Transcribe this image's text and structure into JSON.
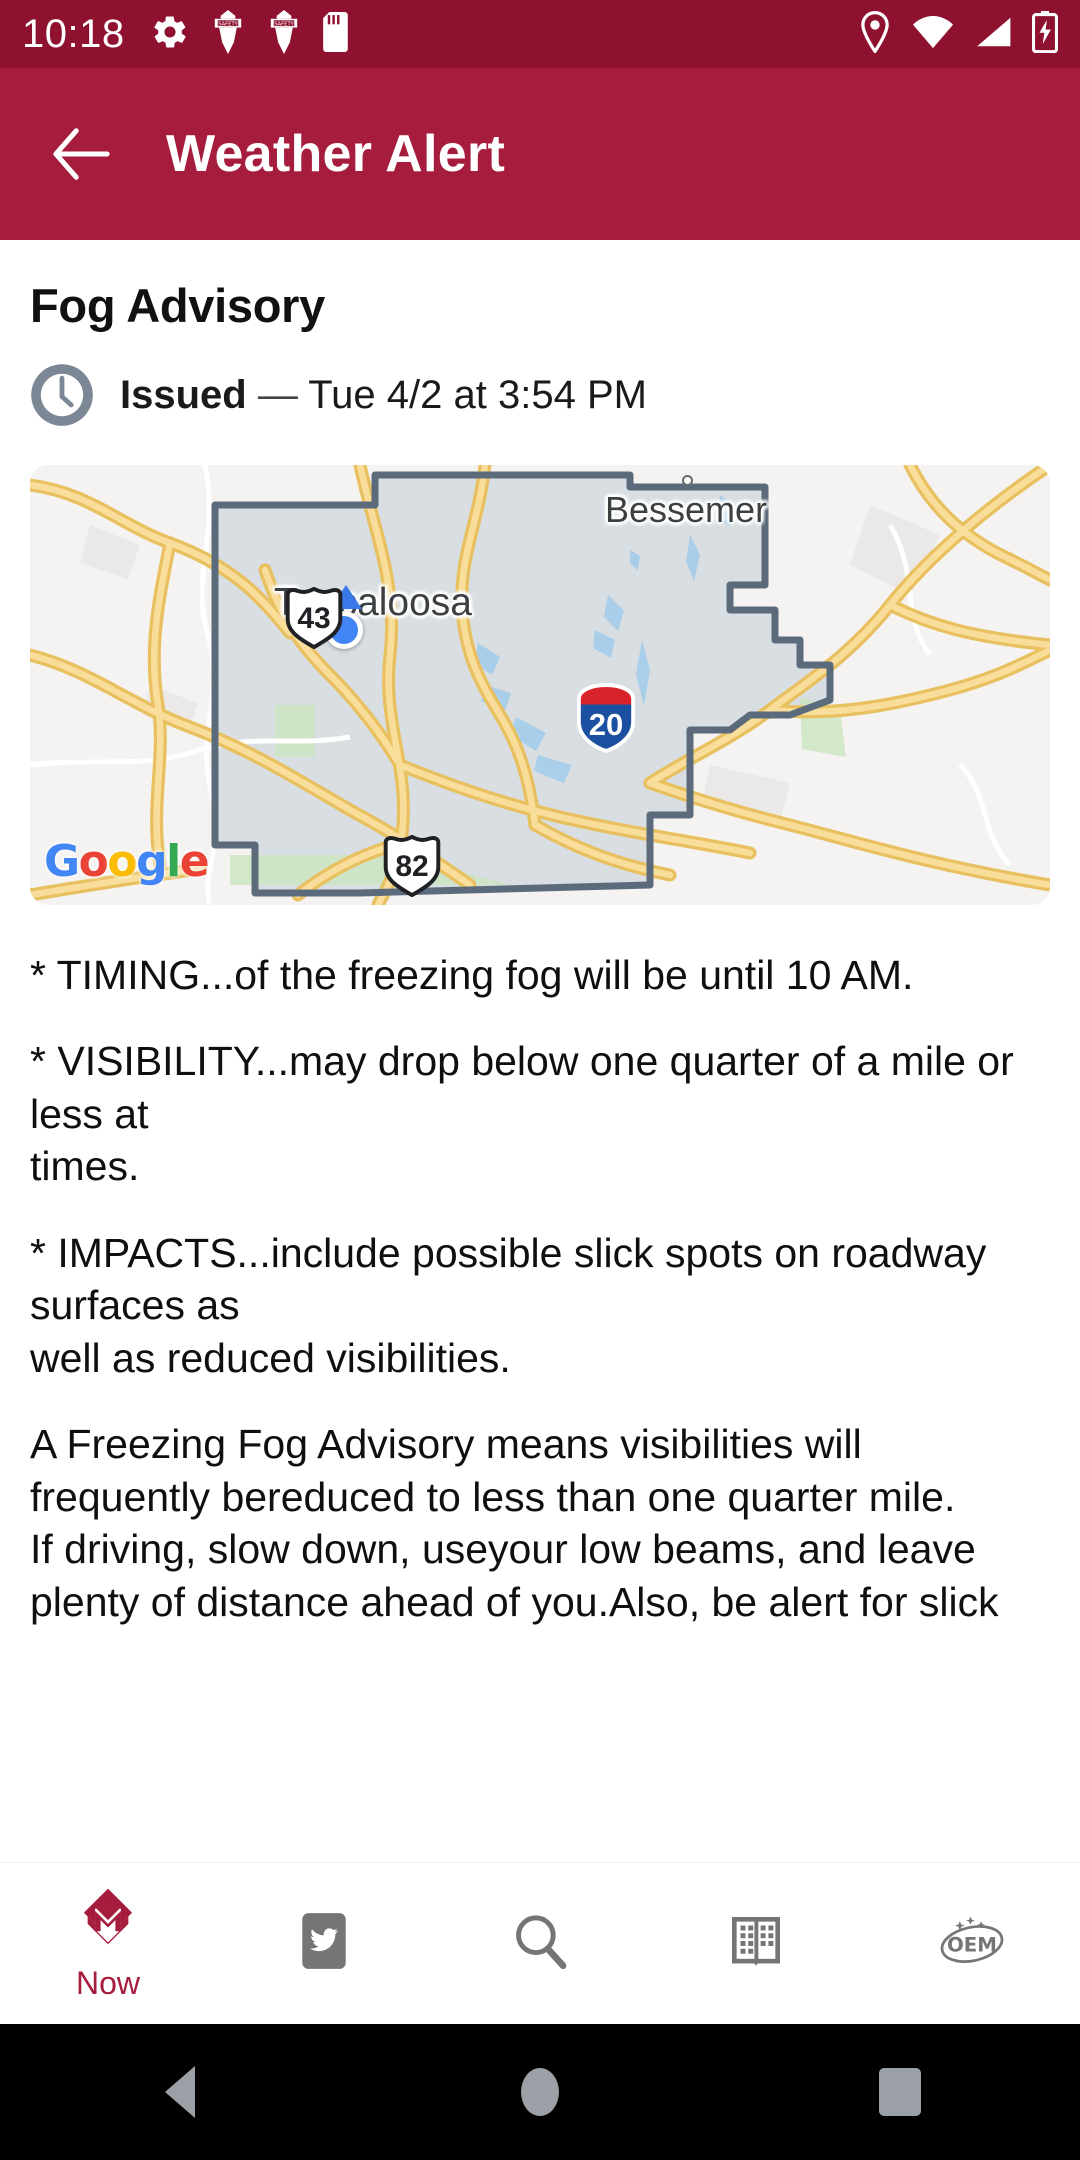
{
  "statusbar": {
    "time": "10:18",
    "left_icons": [
      "gear-icon",
      "safety-badge-icon",
      "safety-badge-icon",
      "sd-card-icon"
    ],
    "right_icons": [
      "location-pin-icon",
      "wifi-icon",
      "cell-signal-icon",
      "battery-charging-icon"
    ],
    "background": "#8E1230"
  },
  "appbar": {
    "back_label": "back-arrow",
    "title": "Weather Alert",
    "background": "#A61C3C"
  },
  "alert": {
    "title": "Fog Advisory",
    "issued_label": "Issued",
    "issued_dash": "—",
    "issued_value": "Tue 4/2 at 3:54 PM",
    "clock_icon": "clock-icon"
  },
  "map": {
    "attribution": "Google",
    "attribution_letters": [
      "G",
      "o",
      "o",
      "g",
      "l",
      "e"
    ],
    "labels": {
      "tuscaloosa": "Tuscaloosa",
      "bessemer": "Bessemer",
      "small_c": "c"
    },
    "shields": {
      "us43": "43",
      "us82": "82",
      "i20": "20"
    },
    "colors": {
      "road": "#F2CE6B",
      "county_outline": "#5B6B7C",
      "county_fill": "#D5DCDF",
      "water": "#A5CDEB",
      "park": "#CDE5C2",
      "land": "#F4F3F1",
      "user_dot": "#4285F4"
    }
  },
  "body": {
    "paragraphs": [
      "* TIMING...of the freezing fog will be until 10 AM.",
      "* VISIBILITY...may drop below one quarter of a mile or less at\ntimes.",
      "* IMPACTS...include possible slick spots on roadway surfaces as\nwell as reduced visibilities.",
      "A Freezing Fog Advisory means visibilities will\nfrequently bereduced to less than one quarter mile.\nIf driving, slow down, useyour low beams, and leave\nplenty of distance ahead of you.Also, be alert for slick"
    ]
  },
  "bottomnav": {
    "items": [
      {
        "icon": "now-logo-icon",
        "label": "Now",
        "active": true
      },
      {
        "icon": "twitter-icon",
        "label": "",
        "active": false
      },
      {
        "icon": "search-icon",
        "label": "",
        "active": false
      },
      {
        "icon": "directory-icon",
        "label": "",
        "active": false
      },
      {
        "icon": "oem-icon",
        "label": "",
        "active": false
      }
    ],
    "active_color": "#A61C3C",
    "inactive_color": "#757575"
  },
  "androidnav": {
    "buttons": [
      "back-triangle-icon",
      "home-circle-icon",
      "recents-square-icon"
    ],
    "background": "#000000"
  }
}
